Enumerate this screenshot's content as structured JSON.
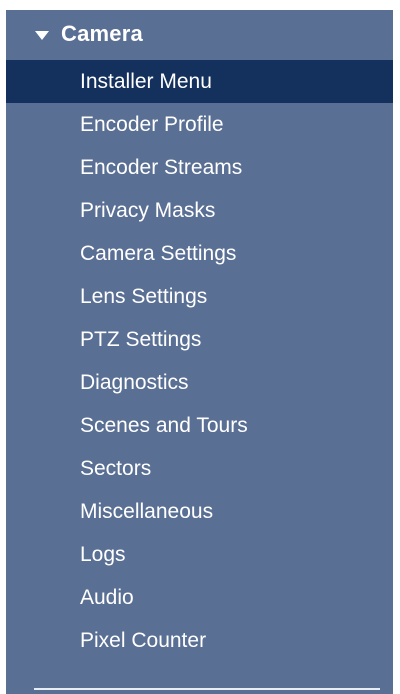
{
  "section": {
    "title": "Camera",
    "expanded_icon": "triangle-down-icon"
  },
  "menu": {
    "items": [
      {
        "label": "Installer Menu",
        "active": true
      },
      {
        "label": "Encoder Profile"
      },
      {
        "label": "Encoder Streams"
      },
      {
        "label": "Privacy Masks"
      },
      {
        "label": "Camera Settings"
      },
      {
        "label": "Lens Settings"
      },
      {
        "label": "PTZ Settings"
      },
      {
        "label": "Diagnostics"
      },
      {
        "label": "Scenes and Tours"
      },
      {
        "label": "Sectors"
      },
      {
        "label": "Miscellaneous"
      },
      {
        "label": "Logs"
      },
      {
        "label": "Audio"
      },
      {
        "label": "Pixel Counter"
      }
    ]
  },
  "colors": {
    "panel_background": "#5a6f94",
    "active_background": "#14315e",
    "text": "#ffffff"
  }
}
